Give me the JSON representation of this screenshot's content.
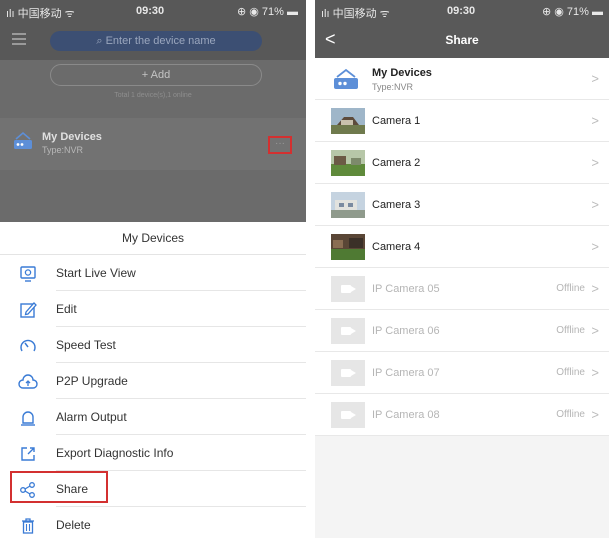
{
  "left": {
    "status": {
      "carrier": "ılı 中国移动 ᯤ",
      "time": "09:30",
      "battery": "⊕ ◉ 71% ▬"
    },
    "header": {
      "search_placeholder": "⌕ Enter the device name"
    },
    "add_label": "+ Add",
    "total_text": "Total 1 device(s),1 online",
    "device": {
      "name": "My Devices",
      "type": "Type:NVR",
      "more_label": "···"
    },
    "sheet": {
      "title": "My Devices",
      "items": [
        {
          "label": "Start Live View",
          "icon": "monitor-icon"
        },
        {
          "label": "Edit",
          "icon": "edit-icon"
        },
        {
          "label": "Speed Test",
          "icon": "speedometer-icon"
        },
        {
          "label": "P2P Upgrade",
          "icon": "cloud-upload-icon"
        },
        {
          "label": "Alarm Output",
          "icon": "alarm-bell-icon"
        },
        {
          "label": "Export Diagnostic Info",
          "icon": "export-icon"
        },
        {
          "label": "Share",
          "icon": "share-icon"
        },
        {
          "label": "Delete",
          "icon": "trash-icon"
        }
      ]
    }
  },
  "right": {
    "status": {
      "carrier": "ılı 中国移动 ᯤ",
      "time": "09:30",
      "battery": "⊕ ◉ 71% ▬"
    },
    "header": {
      "back": "<",
      "title": "Share"
    },
    "device": {
      "name": "My Devices",
      "type": "Type:NVR"
    },
    "cameras": [
      {
        "name": "Camera 1",
        "status": ""
      },
      {
        "name": "Camera 2",
        "status": ""
      },
      {
        "name": "Camera 3",
        "status": ""
      },
      {
        "name": "Camera 4",
        "status": ""
      },
      {
        "name": "IP Camera 05",
        "status": "Offline"
      },
      {
        "name": "IP Camera 06",
        "status": "Offline"
      },
      {
        "name": "IP Camera 07",
        "status": "Offline"
      },
      {
        "name": "IP Camera 08",
        "status": "Offline"
      }
    ],
    "chevron": ">"
  },
  "colors": {
    "highlight": "#d33030",
    "search_bg": "#3c4f73",
    "icon_blue": "#3a7bd5",
    "header_gray": "#595959"
  }
}
